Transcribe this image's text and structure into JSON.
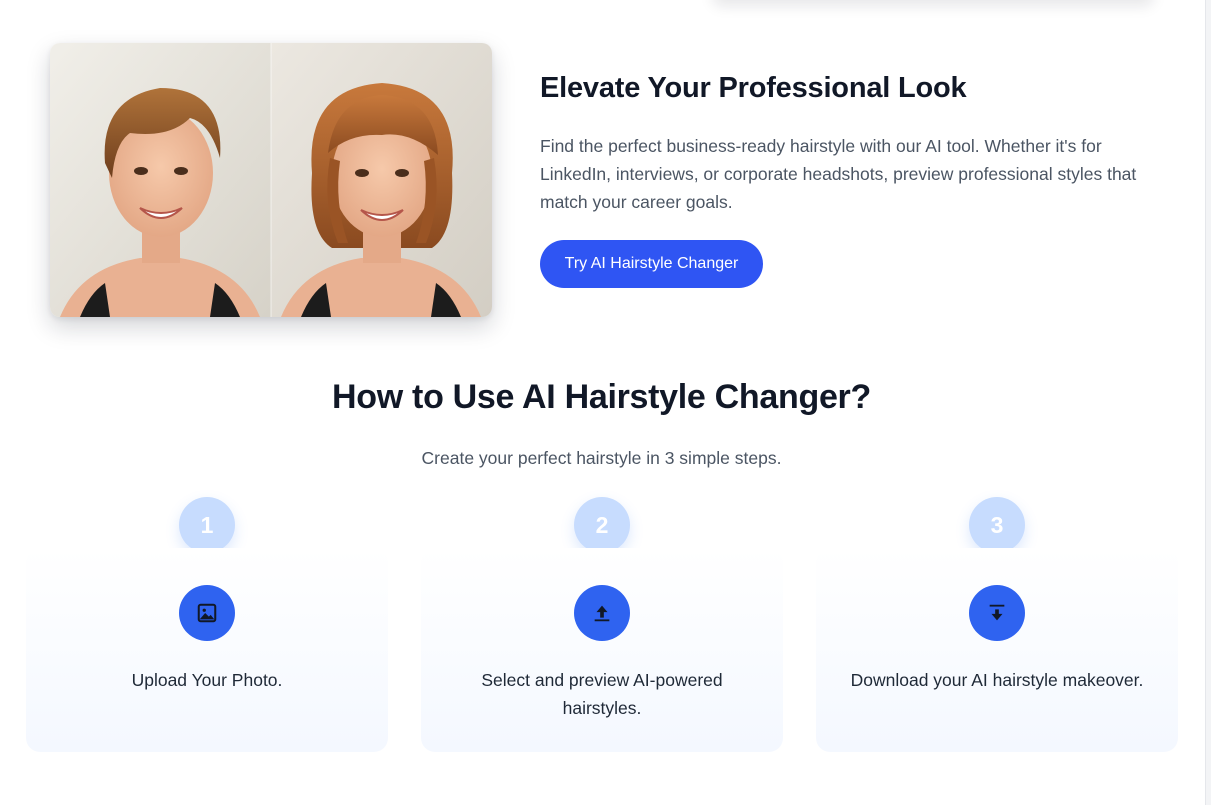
{
  "hero": {
    "title": "Elevate Your Professional Look",
    "description": "Find the perfect business-ready hairstyle with our AI tool. Whether it's for LinkedIn, interviews, or corporate headshots, preview professional styles that match your career goals.",
    "cta_label": "Try AI Hairstyle Changer",
    "image_icon": "before-after-portrait",
    "accent_color": "#2f55f3"
  },
  "howto": {
    "title": "How to Use AI Hairstyle Changer?",
    "subtitle": "Create your perfect hairstyle in 3 simple steps.",
    "steps": [
      {
        "number": "1",
        "icon": "image-icon",
        "text": "Upload Your Photo."
      },
      {
        "number": "2",
        "icon": "upload-icon",
        "text": "Select and preview AI-powered hairstyles."
      },
      {
        "number": "3",
        "icon": "download-icon",
        "text": "Download your AI hairstyle makeover."
      }
    ]
  }
}
